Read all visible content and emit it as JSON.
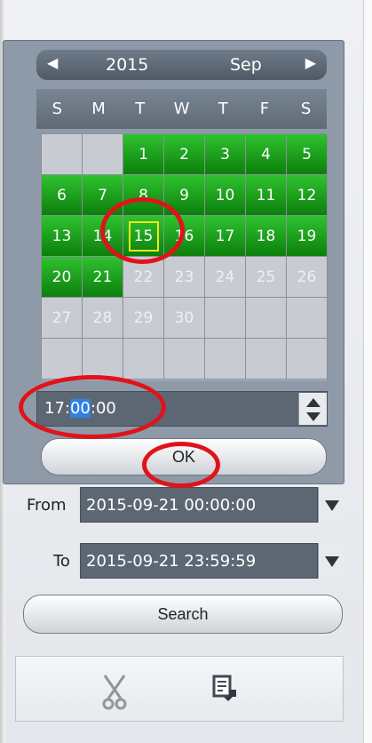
{
  "calendar": {
    "year": "2015",
    "month": "Sep",
    "weekdays": [
      "S",
      "M",
      "T",
      "W",
      "T",
      "F",
      "S"
    ],
    "days": [
      [
        "",
        "",
        "1",
        "2",
        "3",
        "4",
        "5"
      ],
      [
        "6",
        "7",
        "8",
        "9",
        "10",
        "11",
        "12"
      ],
      [
        "13",
        "14",
        "15",
        "16",
        "17",
        "18",
        "19"
      ],
      [
        "20",
        "21",
        "22",
        "23",
        "24",
        "25",
        "26"
      ],
      [
        "27",
        "28",
        "29",
        "30",
        "",
        "",
        ""
      ],
      [
        "",
        "",
        "",
        "",
        "",
        "",
        ""
      ]
    ],
    "green_days": [
      "1",
      "2",
      "3",
      "4",
      "5",
      "6",
      "7",
      "8",
      "9",
      "10",
      "11",
      "12",
      "13",
      "14",
      "15",
      "16",
      "17",
      "18",
      "19",
      "20",
      "21"
    ],
    "selected_day": "15",
    "time_parts": {
      "hour": "17:",
      "minute": "00",
      "second": ":00"
    }
  },
  "buttons": {
    "ok": "OK",
    "search": "Search"
  },
  "range": {
    "from_label": "From",
    "from_value": "2015-09-21 00:00:00",
    "to_label": "To",
    "to_value": "2015-09-21 23:59:59"
  },
  "icons": {
    "left": "left-arrow-icon",
    "right": "right-arrow-icon",
    "scissors": "scissors-icon",
    "export": "export-icon"
  },
  "colors": {
    "green": "#21a321",
    "selection_border": "#f6e51a",
    "annotation": "#e0131b",
    "field": "#5d6774"
  }
}
